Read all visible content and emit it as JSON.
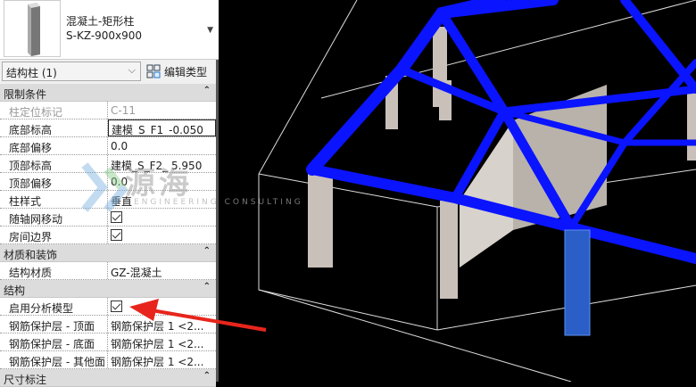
{
  "type_selector": {
    "family": "混凝土-矩形柱",
    "type": "S-KZ-900x900"
  },
  "instance_filter": "结构柱 (1)",
  "edit_type_label": "编辑类型",
  "sections": [
    {
      "title": "限制条件",
      "rows": [
        {
          "key": "柱定位标记",
          "value": "C-11"
        },
        {
          "key": "底部标高",
          "value": "建模_S_F1_-0.050"
        },
        {
          "key": "底部偏移",
          "value": "0.0"
        },
        {
          "key": "顶部标高",
          "value": "建模_S_F2_ 5.950"
        },
        {
          "key": "顶部偏移",
          "value": "0.0"
        },
        {
          "key": "柱样式",
          "value": "垂直"
        },
        {
          "key": "随轴网移动",
          "checked": true
        },
        {
          "key": "房间边界",
          "checked": true
        }
      ]
    },
    {
      "title": "材质和装饰",
      "rows": [
        {
          "key": "结构材质",
          "value": "GZ-混凝土"
        }
      ]
    },
    {
      "title": "结构",
      "rows": [
        {
          "key": "启用分析模型",
          "checked": true
        },
        {
          "key": "钢筋保护层 - 顶面",
          "value": "钢筋保护层 1 <2..."
        },
        {
          "key": "钢筋保护层 - 底面",
          "value": "钢筋保护层 1 <2..."
        },
        {
          "key": "钢筋保护层 - 其他面",
          "value": "钢筋保护层 1 <2..."
        }
      ]
    },
    {
      "title": "尺寸标注"
    }
  ],
  "watermark": {
    "name": "源海",
    "sub": "ENGINEERING CONSULTING"
  },
  "colors": {
    "beam": "#0a14ff",
    "annotation_arrow": "#e8251c",
    "selected_column": "#2b5fc7"
  }
}
